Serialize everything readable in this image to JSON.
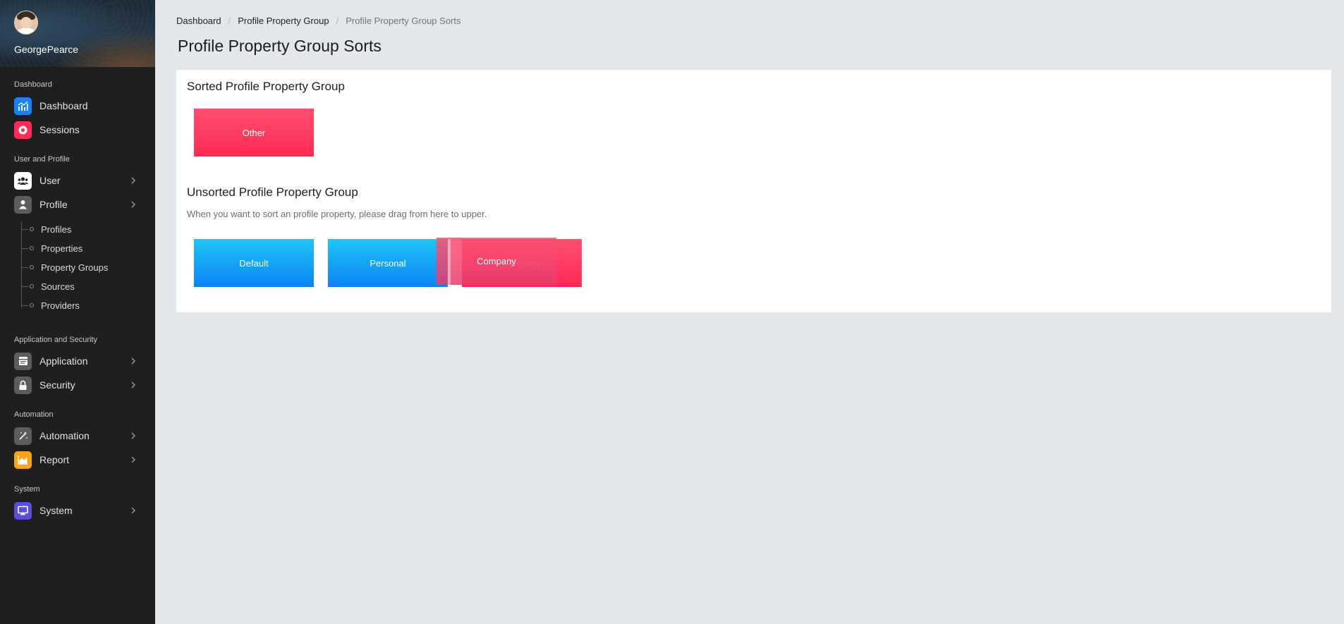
{
  "sidebar": {
    "user": {
      "name": "GeorgePearce"
    },
    "sections": {
      "dashboard": "Dashboard",
      "user_profile": "User and Profile",
      "app_security": "Application and Security",
      "automation": "Automation",
      "system": "System"
    },
    "items": {
      "dashboard": "Dashboard",
      "sessions": "Sessions",
      "user": "User",
      "profile": "Profile",
      "application": "Application",
      "security": "Security",
      "automation": "Automation",
      "report": "Report",
      "system": "System"
    },
    "profile_sub": [
      "Profiles",
      "Properties",
      "Property Groups",
      "Sources",
      "Providers"
    ],
    "icon_colors": {
      "dashboard": "#1a82f7",
      "sessions": "#ff2d55",
      "user": "#ffffff",
      "profile": "#5c5c5c",
      "application": "#5c5c5c",
      "security": "#5c5c5c",
      "automation": "#5c5c5c",
      "report": "#f7a31c",
      "system": "#5a4fd8"
    },
    "icons": {
      "dashboard": "chart-icon",
      "sessions": "record-icon",
      "user": "users-group-icon",
      "profile": "person-icon",
      "application": "window-icon",
      "security": "lock-icon",
      "automation": "magic-wand-icon",
      "report": "area-chart-icon",
      "system": "monitor-icon"
    }
  },
  "breadcrumb": [
    "Dashboard",
    "Profile Property Group",
    "Profile Property Group Sorts"
  ],
  "page": {
    "title": "Profile Property Group Sorts"
  },
  "sorted": {
    "heading": "Sorted Profile Property Group",
    "items": [
      "Other"
    ]
  },
  "unsorted": {
    "heading": "Unsorted Profile Property Group",
    "hint": "When you want to sort an profile property, please drag from here to upper.",
    "items": [
      "Default",
      "Personal",
      "Company"
    ]
  },
  "dragging": {
    "label": "Company"
  },
  "colors": {
    "sorted_tile": "#ff3a60",
    "unsorted_tile": "#0f90f5",
    "sidebar_bg": "#1f1f1f",
    "page_bg": "#e4e7e9"
  }
}
